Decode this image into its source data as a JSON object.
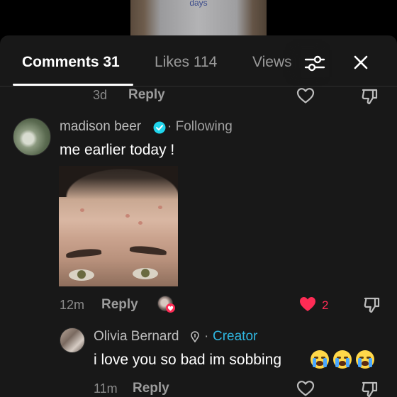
{
  "video": {
    "caption": "days"
  },
  "tabs": {
    "comments": "Comments 31",
    "likes": "Likes 114",
    "views": "Views"
  },
  "previous_comment": {
    "time": "3d",
    "reply": "Reply"
  },
  "comment": {
    "username": "madison beer",
    "following": "· Following",
    "text": "me earlier today !",
    "time": "12m",
    "reply": "Reply",
    "like_count": "2"
  },
  "reply_comment": {
    "username": "Olivia Bernard",
    "creator_label": "Creator",
    "separator": "·",
    "text": "i love you so bad im sobbing",
    "emojis": [
      "loudly-crying-face",
      "loudly-crying-face",
      "loudly-crying-face"
    ],
    "time": "11m",
    "reply": "Reply"
  },
  "colors": {
    "sheet_bg": "#181818",
    "accent_like": "#fe2c55",
    "creator": "#2fb6e0",
    "verified": "#20d5ec"
  },
  "icons": {
    "filter": "filter-sliders-icon",
    "close": "close-icon",
    "like": "heart-outline-icon",
    "liked": "heart-filled-icon",
    "dislike": "thumbs-down-icon",
    "verified": "verified-badge-icon"
  }
}
